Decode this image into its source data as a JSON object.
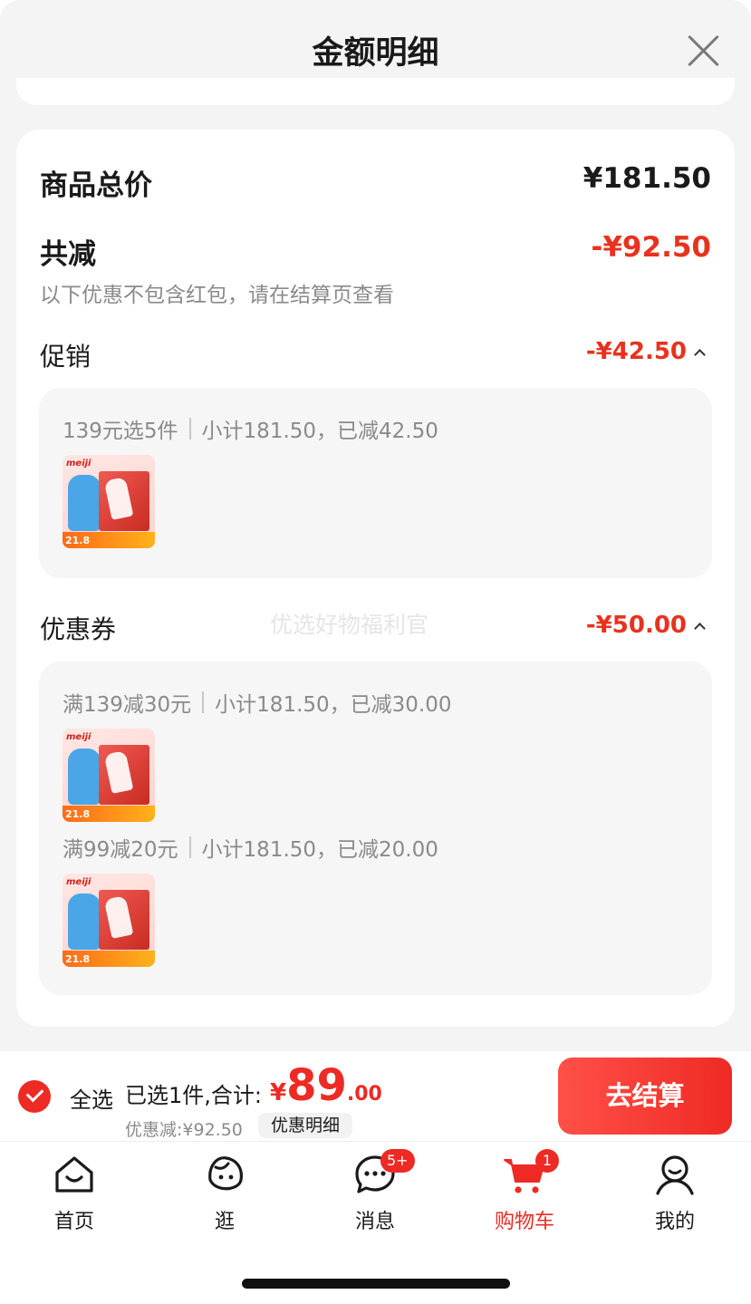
{
  "header": {
    "title": "金额明细"
  },
  "summary": {
    "total_label": "商品总价",
    "total_value": "¥181.50",
    "reduced_label": "共减",
    "reduced_value": "-¥92.50",
    "note": "以下优惠不包含红包，请在结算页查看"
  },
  "promotion": {
    "title": "促销",
    "value": "-¥42.50",
    "rules": [
      {
        "rule": "139元选5件",
        "subtotal": "小计181.50，已减42.50",
        "product_price": "21.8"
      }
    ]
  },
  "coupon": {
    "title": "优惠券",
    "value": "-¥50.00",
    "rules": [
      {
        "rule": "满139减30元",
        "subtotal": "小计181.50，已减30.00",
        "product_price": "21.8"
      },
      {
        "rule": "满99减20元",
        "subtotal": "小计181.50，已减20.00",
        "product_price": "21.8"
      }
    ]
  },
  "product": {
    "brand": "meiji"
  },
  "watermark": "优选好物福利官",
  "footer": {
    "select_all": "全选",
    "selected_text": "已选1件,合计:",
    "currency": "¥",
    "amount_int": "89",
    "amount_dec": ".00",
    "discount_text": "优惠减:¥92.50",
    "detail_label": "优惠明细",
    "checkout_label": "去结算"
  },
  "tabs": [
    {
      "label": "首页",
      "icon": "home-icon"
    },
    {
      "label": "逛",
      "icon": "explore-icon"
    },
    {
      "label": "消息",
      "icon": "message-icon",
      "badge": "5+"
    },
    {
      "label": "购物车",
      "icon": "cart-icon",
      "badge": "1",
      "active": true
    },
    {
      "label": "我的",
      "icon": "profile-icon"
    }
  ],
  "colors": {
    "accent": "#ee2a24",
    "price_red": "#e8321e"
  }
}
